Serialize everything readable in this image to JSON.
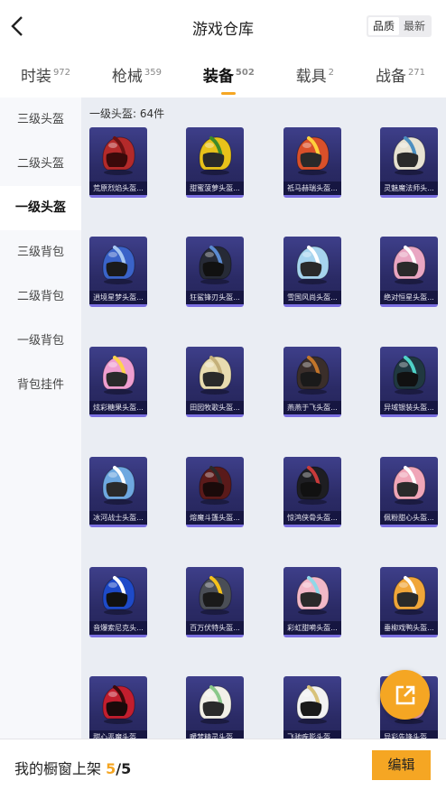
{
  "header": {
    "title": "游戏仓库",
    "sort": [
      "品质",
      "最新"
    ],
    "sort_active": 0
  },
  "tabs": [
    {
      "label": "时装",
      "count": "972"
    },
    {
      "label": "枪械",
      "count": "359"
    },
    {
      "label": "装备",
      "count": "502"
    },
    {
      "label": "载具",
      "count": "2"
    },
    {
      "label": "战备",
      "count": "271"
    }
  ],
  "active_tab": 2,
  "sidebar": [
    "三级头盔",
    "二级头盔",
    "一级头盔",
    "三级背包",
    "二级背包",
    "一级背包",
    "背包挂件"
  ],
  "active_side": 2,
  "section_count": "一级头盔: 64件",
  "items": [
    {
      "name": "荒原烈焰头盔...",
      "color": "#b32a2a",
      "accent": "#6a1212",
      "visor": "#3a0a0a"
    },
    {
      "name": "甜蜜菠萝头盔...",
      "color": "#e8c21a",
      "accent": "#3d8a2a",
      "visor": "#2a2a2a"
    },
    {
      "name": "祗马赫瑞头盔...",
      "color": "#d9502a",
      "accent": "#ffd23c",
      "visor": "#2a2a2a"
    },
    {
      "name": "灵魅魔法师头...",
      "color": "#e7e2d2",
      "accent": "#4c8fc0",
      "visor": "#2a2a2a"
    },
    {
      "name": "逍境星梦头盔...",
      "color": "#3a63c8",
      "accent": "#a8c8f2",
      "visor": "#1a1a1a"
    },
    {
      "name": "狂鲨锋刃头盔...",
      "color": "#262a36",
      "accent": "#5a8ad0",
      "visor": "#111111"
    },
    {
      "name": "雪国风尚头盔...",
      "color": "#a6d4ee",
      "accent": "#ffffff",
      "visor": "#2a2a2a"
    },
    {
      "name": "绝对恒星头盔...",
      "color": "#e9a6c2",
      "accent": "#ffffff",
      "visor": "#2a2a2a"
    },
    {
      "name": "炫彩糖果头盔...",
      "color": "#ef9ed0",
      "accent": "#ffd34a",
      "visor": "#2a2a2a"
    },
    {
      "name": "田园牧歌头盔...",
      "color": "#e8dcb0",
      "accent": "#c4b07a",
      "visor": "#2a2a2a"
    },
    {
      "name": "燕燕于飞头盔...",
      "color": "#3a2e2a",
      "accent": "#c2752a",
      "visor": "#1a1a1a"
    },
    {
      "name": "异域银装头盔...",
      "color": "#203840",
      "accent": "#4fd3c8",
      "visor": "#111111"
    },
    {
      "name": "冰河战士头盔...",
      "color": "#6ea8e0",
      "accent": "#ffffff",
      "visor": "#2a2a2a"
    },
    {
      "name": "熔魔斗篷头盔...",
      "color": "#5a1a1a",
      "accent": "#2a2a2a",
      "visor": "#1a0a0a"
    },
    {
      "name": "惊鸿侠骨头盔...",
      "color": "#1e1e22",
      "accent": "#c83a3a",
      "visor": "#111111"
    },
    {
      "name": "佩粉甜心头盔...",
      "color": "#f0a6b8",
      "accent": "#ffffff",
      "visor": "#2a2a2a"
    },
    {
      "name": "音爆索尼克头...",
      "color": "#1e4ac8",
      "accent": "#ffffff",
      "visor": "#111111"
    },
    {
      "name": "百万伏特头盔...",
      "color": "#4a4e56",
      "accent": "#f5c21a",
      "visor": "#1a1a1a"
    },
    {
      "name": "彩虹甜嗬头盔...",
      "color": "#f2b8c8",
      "accent": "#8fd8e8",
      "visor": "#2a2a2a"
    },
    {
      "name": "垂柳戏鸭头盔...",
      "color": "#f0a63a",
      "accent": "#ffffff",
      "visor": "#2a2a2a"
    },
    {
      "name": "甜心恶魔头盔...",
      "color": "#c21e2e",
      "accent": "#3a0a0a",
      "visor": "#1a0a0a"
    },
    {
      "name": "暖梦精灵头盔...",
      "color": "#f2f0e8",
      "accent": "#8ac88a",
      "visor": "#2a2a2a"
    },
    {
      "name": "飞驰疾影头盔...",
      "color": "#f2f2f2",
      "accent": "#d8c27a",
      "visor": "#1a1a1a"
    },
    {
      "name": "异彩先锋头盔...",
      "color": "#f2a6c8",
      "accent": "#7ad8e8",
      "visor": "#2a2a2a"
    }
  ],
  "footer": {
    "label": "我的橱窗上架",
    "current": "5",
    "total": "/5",
    "edit_label": "编辑"
  },
  "icons": {
    "back": "chevron-left-icon",
    "share": "share-icon"
  },
  "colors": {
    "accent": "#f5a623",
    "card_bg": "#2b2b66"
  }
}
